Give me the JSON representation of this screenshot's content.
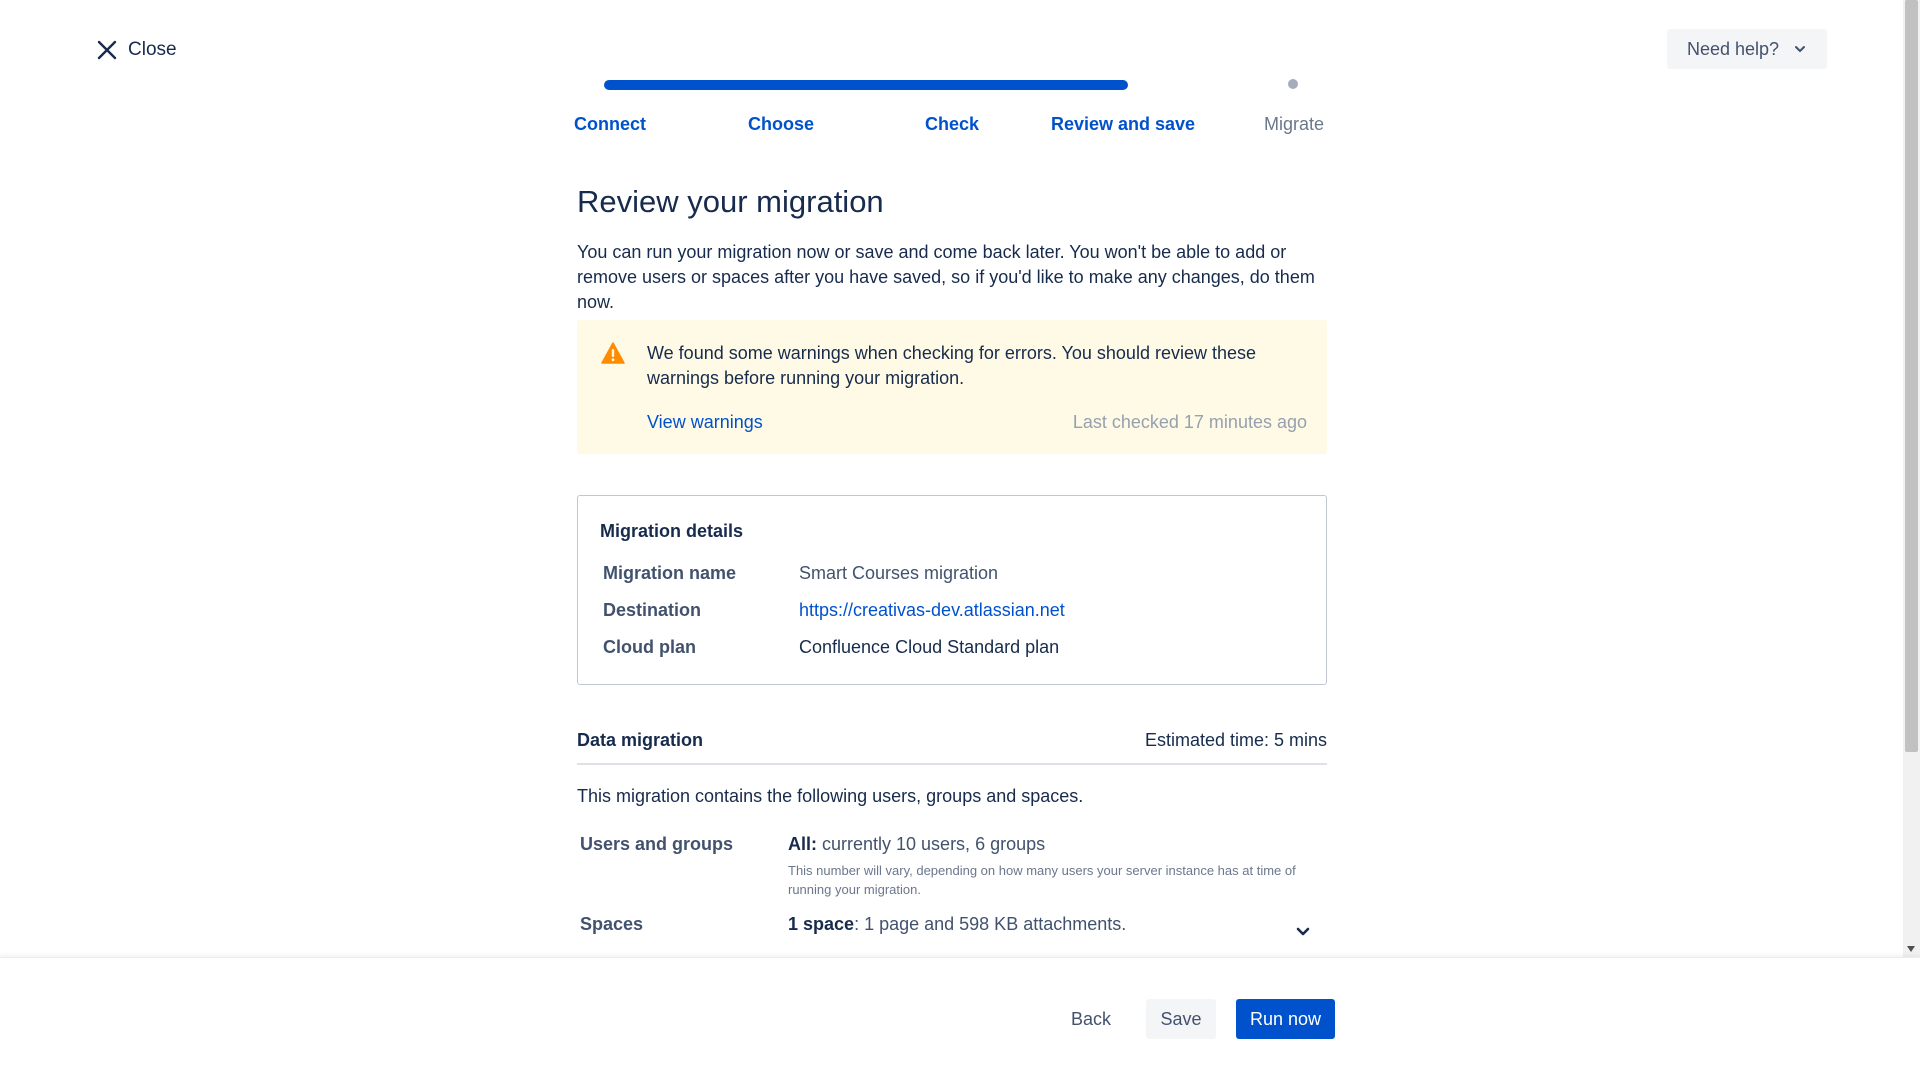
{
  "header": {
    "close_label": "Close",
    "help_label": "Need help?"
  },
  "steps": [
    {
      "label": "Connect",
      "state": "complete"
    },
    {
      "label": "Choose",
      "state": "complete"
    },
    {
      "label": "Check",
      "state": "complete"
    },
    {
      "label": "Review and save",
      "state": "current"
    },
    {
      "label": "Migrate",
      "state": "upcoming"
    }
  ],
  "main": {
    "title": "Review your migration",
    "intro": "You can run your migration now or save and come back later. You won't be able to add or remove users or spaces after you have saved, so if you'd like to make any changes, do them now."
  },
  "warning": {
    "text": "We found some warnings when checking for errors. You should review these warnings before running your migration.",
    "link": "View warnings",
    "last_checked": "Last checked 17 minutes ago"
  },
  "details": {
    "title": "Migration details",
    "rows": [
      {
        "label": "Migration name",
        "value": "Smart Courses migration"
      },
      {
        "label": "Destination",
        "value": "https://creativas-dev.atlassian.net"
      },
      {
        "label": "Cloud plan",
        "value": "Confluence Cloud Standard plan"
      }
    ]
  },
  "data_migration": {
    "title": "Data migration",
    "estimate": "Estimated time: 5 mins",
    "intro": "This migration contains the following users, groups and spaces.",
    "users": {
      "label": "Users and groups",
      "value_bold": "All:",
      "value": " currently 10 users, 6 groups",
      "note": "This number will vary, depending on how many users your server instance has at time of running your migration."
    },
    "spaces": {
      "label": "Spaces",
      "value_bold": "1 space",
      "value": ": 1 page and 598 KB attachments."
    }
  },
  "footer": {
    "back": "Back",
    "save": "Save",
    "run": "Run now"
  },
  "colors": {
    "primary": "#0052cc",
    "text": "#172b4d",
    "subtle": "#42526e",
    "warning_bg": "#fffae6",
    "warning_icon": "#ff8b00"
  }
}
